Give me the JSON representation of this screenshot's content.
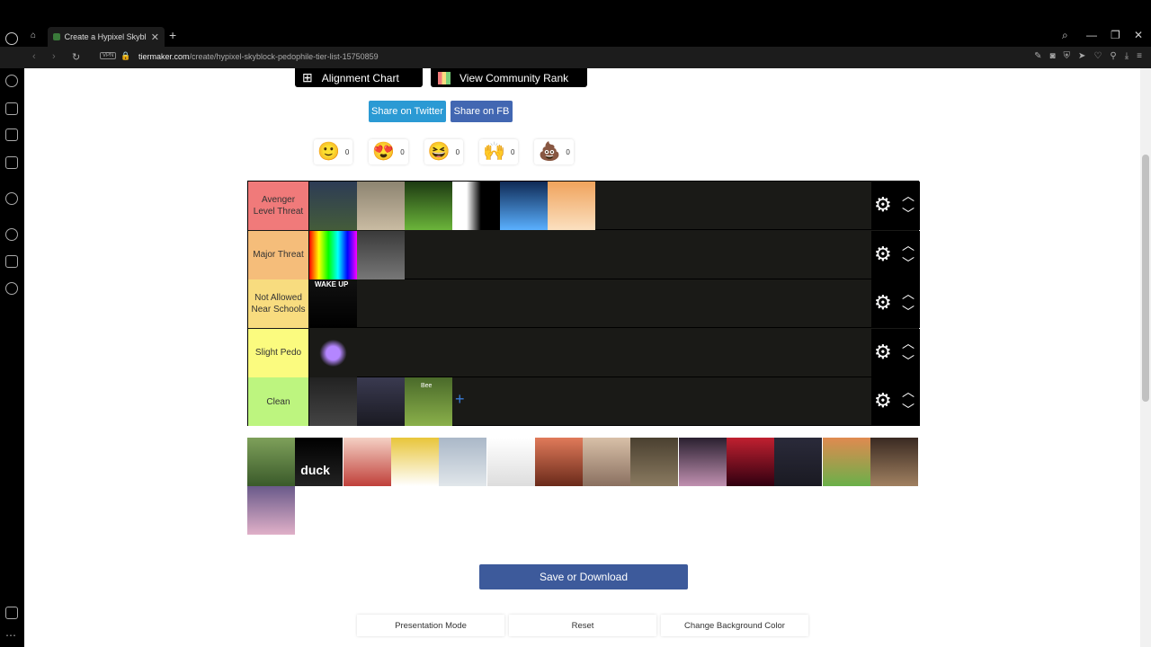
{
  "browser": {
    "tab_title": "Create a Hypixel Skyblock",
    "url_domain": "tiermaker.com",
    "url_path": "/create/hypixel-skyblock-pedophile-tier-list-15750859",
    "vpn_label": "VPN"
  },
  "header_buttons": {
    "alignment": "Alignment Chart",
    "community": "View Community Rank",
    "share_twitter": "Share on Twitter",
    "share_fb": "Share on FB"
  },
  "reactions": [
    {
      "icon": "slight-smile",
      "emoji": "🙂",
      "count": "0"
    },
    {
      "icon": "heart-eyes",
      "emoji": "😍",
      "count": "0"
    },
    {
      "icon": "laughing",
      "emoji": "😆",
      "count": "0"
    },
    {
      "icon": "raised-hands",
      "emoji": "🙌",
      "count": "0"
    },
    {
      "icon": "poop",
      "emoji": "💩",
      "count": "0"
    }
  ],
  "tiers": [
    {
      "label": "Avenger Level Threat",
      "color": "#f07a7a",
      "item_count": 6
    },
    {
      "label": "Major Threat",
      "color": "#f5bd7a",
      "item_count": 2
    },
    {
      "label": "Not Allowed Near Schools",
      "color": "#f8dc7f",
      "item_count": 1
    },
    {
      "label": "Slight Pedo",
      "color": "#fbfb7f",
      "item_count": 1
    },
    {
      "label": "Clean",
      "color": "#bdf57f",
      "item_count": 3
    }
  ],
  "pool_item_count": 15,
  "wake_up_text": "WAKE UP",
  "duck_text": "duck",
  "bee_text": "Bee",
  "footer": {
    "save": "Save or Download",
    "presentation": "Presentation Mode",
    "reset": "Reset",
    "change_bg": "Change Background Color"
  }
}
